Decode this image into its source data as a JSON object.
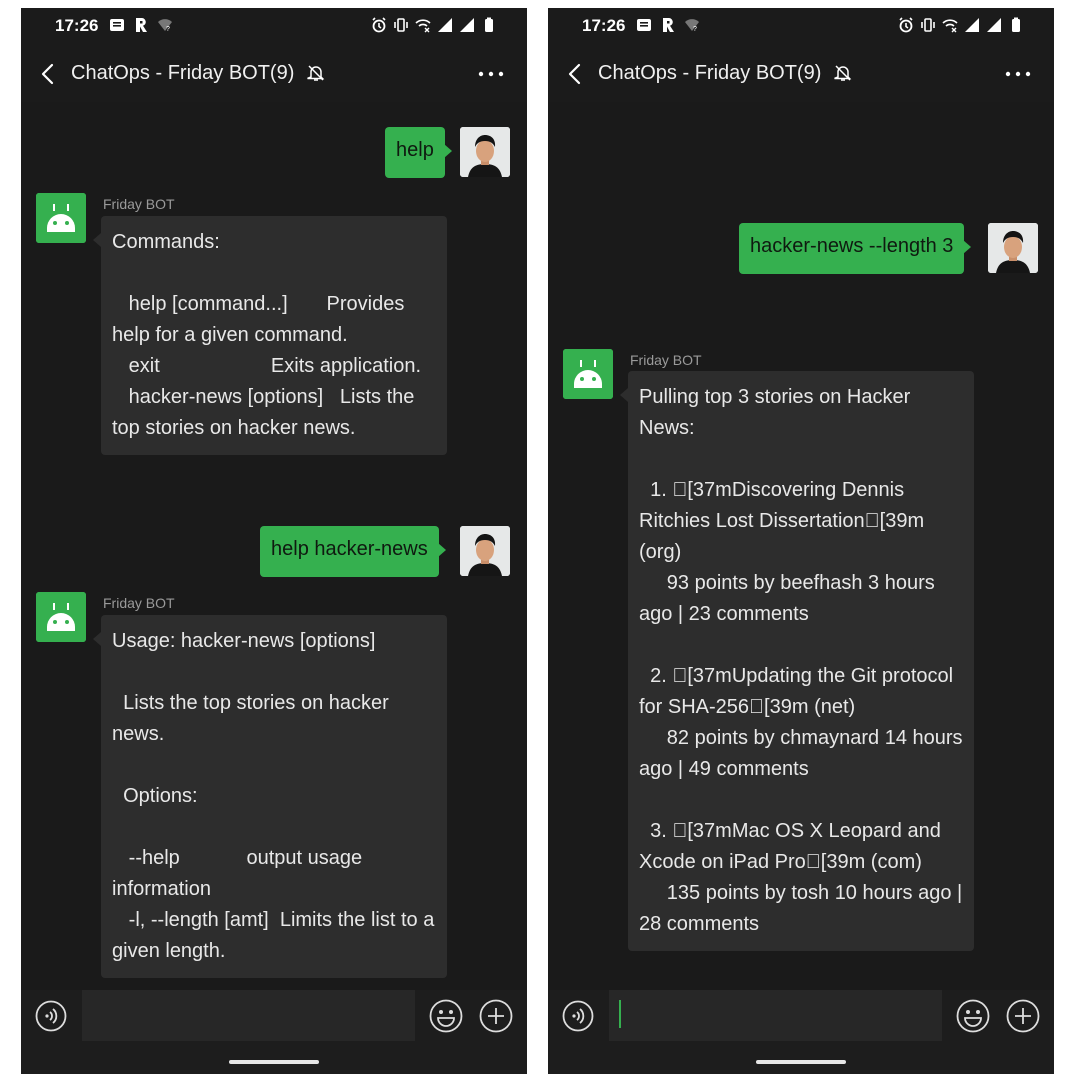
{
  "colors": {
    "accent_green": "#35b04f",
    "background": "#1a1a1a",
    "bubble_bot": "#2d2d2d"
  },
  "status_bar": {
    "time": "17:26"
  },
  "chat": {
    "title": "ChatOps - Friday BOT(9)"
  },
  "sender_bot": "Friday BOT",
  "left_screen": {
    "msg1_out": "help",
    "msg2_in": "Commands:\n\n   help [command...]       Provides help for a given command.\n   exit                    Exits application.\n   hacker-news [options]   Lists the top stories on hacker news.",
    "msg3_out": "help hacker-news",
    "msg4_in": "Usage: hacker-news [options]\n\n  Lists the top stories on hacker news.\n\n  Options:\n\n   --help            output usage information\n   -l, --length [amt]  Limits the list to a given length."
  },
  "right_screen": {
    "msg1_out": "hacker-news --length 3",
    "msg2_in": "Pulling top 3 stories on Hacker News:\n\n  1. \u0000[37mDiscovering Dennis Ritchies Lost Dissertation\u0000[39m (org)\n     93 points by beefhash 3 hours ago | 23 comments\n\n  2. \u0000[37mUpdating the Git protocol for SHA-256\u0000[39m (net)\n     82 points by chmaynard 14 hours ago | 49 comments\n\n  3. \u0000[37mMac OS X Leopard and Xcode on iPad Pro\u0000[39m (com)\n     135 points by tosh 10 hours ago | 28 comments"
  },
  "icons": {
    "back": "chevron-left-icon",
    "mute": "bell-off-icon",
    "more": "more-dots-icon",
    "voice": "voice-icon",
    "emoji": "emoji-icon",
    "plus": "plus-icon"
  }
}
